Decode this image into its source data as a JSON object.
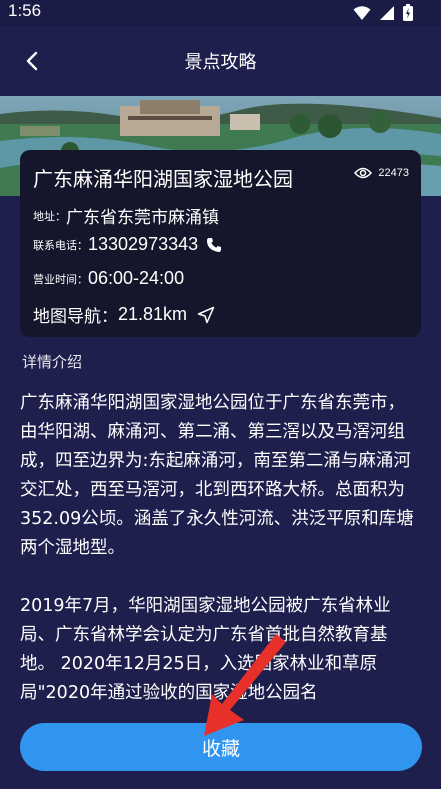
{
  "status_bar": {
    "time": "1:56"
  },
  "header": {
    "title": "景点攻略"
  },
  "park": {
    "name": "广东麻涌华阳湖国家湿地公园",
    "views": "22473",
    "address_label": "地址：",
    "address": "广东省东莞市麻涌镇",
    "phone_label": "联系电话：",
    "phone": "13302973343",
    "hours_label": "营业时间：",
    "hours": "06:00-24:00",
    "map_label": "地图导航：",
    "distance": "21.81km"
  },
  "detail": {
    "section_title": "详情介绍",
    "paragraphs": [
      "广东麻涌华阳湖国家湿地公园位于广东省东莞市，由华阳湖、麻涌河、第二涌、第三滘以及马滘河组成，四至边界为:东起麻涌河，南至第二涌与麻涌河交汇处，西至马滘河，北到西环路大桥。总面积为352.09公顷。涵盖了永久性河流、洪泛平原和库塘两个湿地型。",
      "2019年7月，华阳湖国家湿地公园被广东省林业局、广东省林学会认定为广东省首批自然教育基地。 2020年12月25日，入选国家林业和草原局\"2020年通过验收的国家湿地公园名"
    ]
  },
  "actions": {
    "favorite_label": "收藏"
  },
  "colors": {
    "background": "#1e1f4c",
    "card": "#15152b",
    "accent": "#2f95ee",
    "arrow": "#e8302a"
  }
}
